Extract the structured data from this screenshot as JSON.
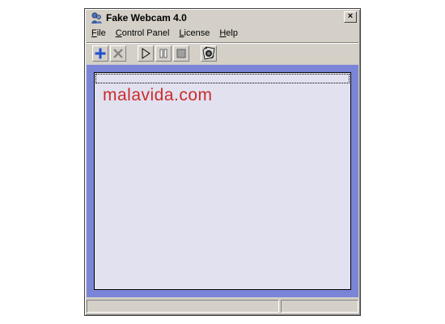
{
  "window": {
    "title": "Fake Webcam 4.0",
    "close_label": "×"
  },
  "menu": {
    "items": [
      {
        "label": "File",
        "accel": "F",
        "rest": "ile"
      },
      {
        "label": "Control Panel",
        "accel": "C",
        "rest": "ontrol Panel"
      },
      {
        "label": "License",
        "accel": "L",
        "rest": "icense"
      },
      {
        "label": "Help",
        "accel": "H",
        "rest": "elp"
      }
    ]
  },
  "toolbar": {
    "buttons": [
      "add-icon",
      "remove-icon",
      "play-icon",
      "pause-icon",
      "stop-icon",
      "webcam-icon"
    ]
  },
  "content": {
    "watermark": "malavida.com",
    "panel_background": "#e1e1f0",
    "frame_color": "#7b85d8"
  },
  "status": {
    "pane_left": "",
    "pane_right": ""
  },
  "colors": {
    "accent": "#7b85d8",
    "watermark": "#cc2b2b"
  }
}
